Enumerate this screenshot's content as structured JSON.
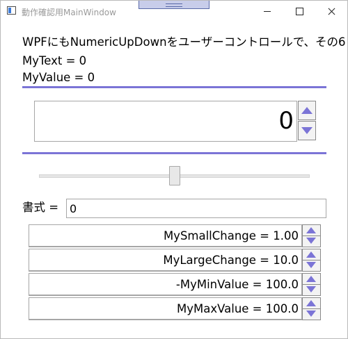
{
  "window": {
    "title": "動作確認用MainWindow"
  },
  "colors": {
    "accent": "#7b74d6",
    "border": "#a6a6a6"
  },
  "content": {
    "heading": "WPFにもNumericUpDownをユーザーコントロールで、その6",
    "my_text": "MyText = 0",
    "my_value": "MyValue = 0"
  },
  "numeric_updown": {
    "value": "0"
  },
  "slider": {
    "value_fraction": 0.5
  },
  "format": {
    "label": "書式 =",
    "value": "0"
  },
  "settings": [
    {
      "label": "MySmallChange = 1.00"
    },
    {
      "label": "MyLargeChange = 10.0"
    },
    {
      "label": "-MyMinValue = 100.0"
    },
    {
      "label": "MyMaxValue = 100.0"
    }
  ]
}
